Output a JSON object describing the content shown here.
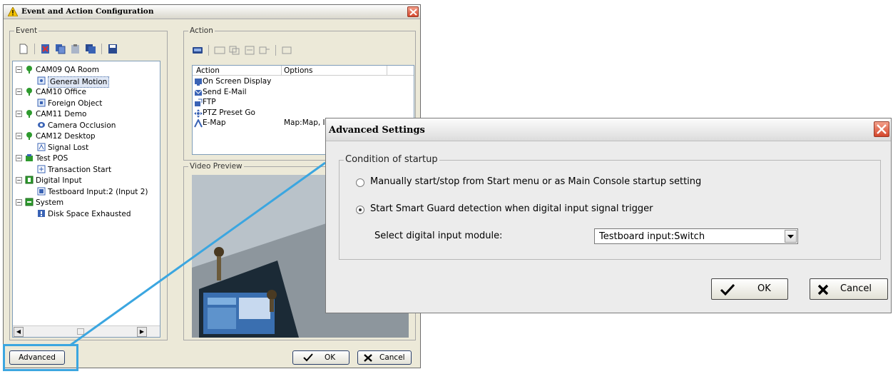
{
  "main_dialog": {
    "title": "Event and Action Configuration",
    "event_group_label": "Event",
    "action_group_label": "Action",
    "video_preview_label": "Video Preview",
    "tree": [
      {
        "label": "CAM09 QA Room",
        "level": 0,
        "icon": "camera-node-icon"
      },
      {
        "label": "General Motion",
        "level": 1,
        "icon": "motion-icon",
        "selected": true
      },
      {
        "label": "CAM10 Office",
        "level": 0,
        "icon": "camera-node-icon"
      },
      {
        "label": "Foreign Object",
        "level": 1,
        "icon": "foreign-object-icon"
      },
      {
        "label": "CAM11 Demo",
        "level": 0,
        "icon": "camera-node-icon"
      },
      {
        "label": "Camera Occlusion",
        "level": 1,
        "icon": "occlusion-icon"
      },
      {
        "label": "CAM12 Desktop",
        "level": 0,
        "icon": "camera-node-icon"
      },
      {
        "label": "Signal Lost",
        "level": 1,
        "icon": "signal-lost-icon"
      },
      {
        "label": "Test POS",
        "level": 0,
        "icon": "pos-icon"
      },
      {
        "label": "Transaction Start",
        "level": 1,
        "icon": "transaction-icon"
      },
      {
        "label": "Digital Input",
        "level": 0,
        "icon": "digital-input-icon"
      },
      {
        "label": "Testboard Input:2 (Input 2)",
        "level": 1,
        "icon": "input-port-icon"
      },
      {
        "label": "System",
        "level": 0,
        "icon": "system-icon"
      },
      {
        "label": "Disk Space Exhausted",
        "level": 1,
        "icon": "disk-warning-icon"
      }
    ],
    "action_columns": [
      "Action",
      "Options"
    ],
    "actions": [
      {
        "action": "On Screen Display",
        "options": "",
        "icon": "osd-icon"
      },
      {
        "action": "Send E-Mail",
        "options": "",
        "icon": "email-icon"
      },
      {
        "action": "FTP",
        "options": "",
        "icon": "ftp-icon"
      },
      {
        "action": "PTZ Preset Go",
        "options": "",
        "icon": "ptz-icon"
      },
      {
        "action": "E-Map",
        "options": "Map:Map, In",
        "icon": "emap-icon"
      }
    ],
    "advanced_label": "Advanced",
    "ok_label": "OK",
    "cancel_label": "Cancel"
  },
  "advanced_dialog": {
    "title": "Advanced Settings",
    "group_label": "Condition of startup",
    "option_manual": "Manually start/stop from Start menu or as Main Console startup setting",
    "option_di": "Start Smart Guard detection when digital input signal trigger",
    "selected_option": "option_di",
    "select_label": "Select digital input module:",
    "select_value": "Testboard input:Switch",
    "ok_label": "OK",
    "cancel_label": "Cancel"
  },
  "colors": {
    "callout": "#3ba6e0",
    "dialog_bg": "#ece9d8",
    "tree_green": "#2e9a2e"
  }
}
